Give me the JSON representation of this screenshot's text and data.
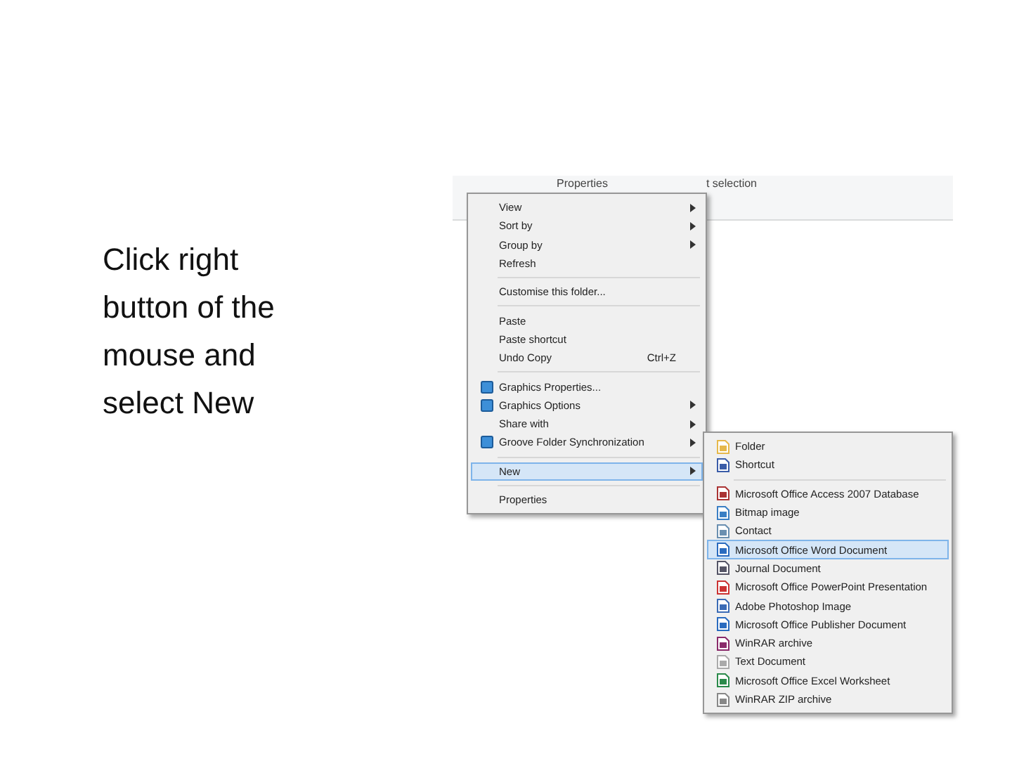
{
  "instruction": "Click right button of the mouse and select New",
  "ribbon": {
    "labels": [
      "Properties",
      "t selection"
    ]
  },
  "context_menu": {
    "items": [
      {
        "kind": "item",
        "label": "View",
        "submenu": true,
        "selected": false
      },
      {
        "kind": "item",
        "label": "Sort by",
        "submenu": true,
        "selected": false
      },
      {
        "kind": "item",
        "label": "Group by",
        "submenu": true,
        "selected": false
      },
      {
        "kind": "item",
        "label": "Refresh",
        "selected": false
      },
      {
        "kind": "separator"
      },
      {
        "kind": "item",
        "label": "Customise this folder...",
        "selected": false
      },
      {
        "kind": "separator"
      },
      {
        "kind": "item",
        "label": "Paste",
        "selected": false
      },
      {
        "kind": "item",
        "label": "Paste shortcut",
        "selected": false
      },
      {
        "kind": "item",
        "label": "Undo Copy",
        "shortcut": "Ctrl+Z",
        "selected": false
      },
      {
        "kind": "separator"
      },
      {
        "kind": "item",
        "label": "Graphics Properties...",
        "has_icon": true,
        "selected": false
      },
      {
        "kind": "item",
        "label": "Graphics Options",
        "has_icon": true,
        "submenu": true,
        "selected": false
      },
      {
        "kind": "item",
        "label": "Share with",
        "submenu": true,
        "selected": false
      },
      {
        "kind": "item",
        "label": "Groove Folder Synchronization",
        "has_icon": true,
        "submenu": true,
        "selected": false
      },
      {
        "kind": "separator"
      },
      {
        "kind": "item",
        "label": "New",
        "submenu": true,
        "selected": true
      },
      {
        "kind": "separator"
      },
      {
        "kind": "item",
        "label": "Properties",
        "selected": false
      }
    ]
  },
  "new_submenu": {
    "items": [
      {
        "kind": "item",
        "label": "Folder",
        "selected": false
      },
      {
        "kind": "item",
        "label": "Shortcut",
        "selected": false
      },
      {
        "kind": "separator"
      },
      {
        "kind": "item",
        "label": "Microsoft Office Access 2007 Database",
        "selected": false
      },
      {
        "kind": "item",
        "label": "Bitmap image",
        "selected": false
      },
      {
        "kind": "item",
        "label": "Contact",
        "selected": false
      },
      {
        "kind": "item",
        "label": "Microsoft Office Word Document",
        "selected": true
      },
      {
        "kind": "item",
        "label": "Journal Document",
        "selected": false
      },
      {
        "kind": "item",
        "label": "Microsoft Office PowerPoint Presentation",
        "selected": false
      },
      {
        "kind": "item",
        "label": "Adobe Photoshop Image",
        "selected": false
      },
      {
        "kind": "item",
        "label": "Microsoft Office Publisher Document",
        "selected": false
      },
      {
        "kind": "item",
        "label": "WinRAR archive",
        "selected": false
      },
      {
        "kind": "item",
        "label": "Text Document",
        "selected": false
      },
      {
        "kind": "item",
        "label": "Microsoft Office Excel Worksheet",
        "selected": false
      },
      {
        "kind": "item",
        "label": "WinRAR ZIP archive",
        "selected": false
      }
    ]
  }
}
